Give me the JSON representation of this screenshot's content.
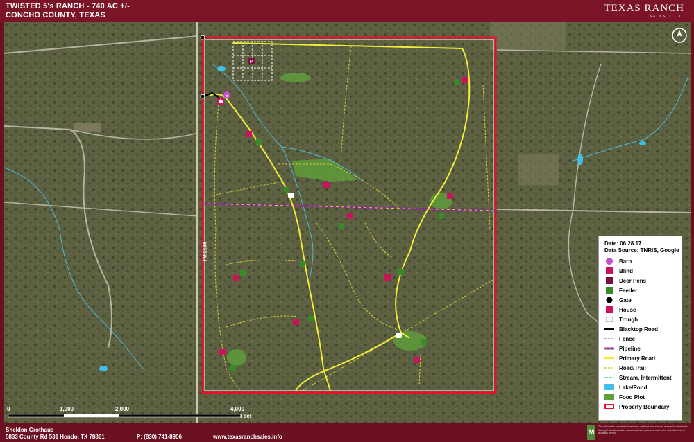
{
  "header": {
    "title_line1": "TWISTED 5's RANCH - 740 AC +/-",
    "title_line2": "CONCHO COUNTY, TEXAS",
    "logo_line1": "TEXAS RANCH",
    "logo_line2": "SALES, L.L.C."
  },
  "road_label": "FM 2134",
  "legend": {
    "date": "Date: 06.28.17",
    "source": "Data Source: TNRIS, Google",
    "items": [
      {
        "label": "Barn",
        "icon": "barn-icon"
      },
      {
        "label": "Blind",
        "icon": "blind-icon"
      },
      {
        "label": "Deer Pens",
        "icon": "deer-pens-icon"
      },
      {
        "label": "Feeder",
        "icon": "feeder-icon"
      },
      {
        "label": "Gate",
        "icon": "gate-icon"
      },
      {
        "label": "House",
        "icon": "house-icon"
      },
      {
        "label": "Trough",
        "icon": "trough-icon"
      },
      {
        "label": "Blacktop Road",
        "icon": "blacktop-road-line"
      },
      {
        "label": "Fence",
        "icon": "fence-line"
      },
      {
        "label": "Pipeline",
        "icon": "pipeline-line"
      },
      {
        "label": "Primary Road",
        "icon": "primary-road-line"
      },
      {
        "label": "Road/Trail",
        "icon": "road-trail-line"
      },
      {
        "label": "Stream, Intermittent",
        "icon": "stream-line"
      },
      {
        "label": "Lake/Pond",
        "icon": "lake-pond-swatch"
      },
      {
        "label": "Food Plot",
        "icon": "food-plot-swatch"
      },
      {
        "label": "Property Boundary",
        "icon": "property-boundary-swatch"
      }
    ]
  },
  "scale_bar": {
    "ticks": [
      "0",
      "1,000",
      "2,000",
      "4,000"
    ],
    "unit": "Feet"
  },
  "footer": {
    "agent_name": "Sheldon Grothaus",
    "address": "5833 County Rd 531 Hondo, TX 78861",
    "phone": "P: (830) 741-8906",
    "website": "www.texasranchsales.info",
    "disclaimer": "The information contained herein was obtained from sources deemed to be reliable. Mapright Services makes no warranties or guarantees as to the completeness or accuracy thereof."
  },
  "colors": {
    "boundary": "#e8102a",
    "primary_road": "#f2ec3a",
    "road_trail": "#d8d23a",
    "stream": "#4fb8d8",
    "food_plot": "#5fa03a",
    "blind": "#c8145a",
    "feeder": "#3a8a2a",
    "header": "#7a1426"
  }
}
